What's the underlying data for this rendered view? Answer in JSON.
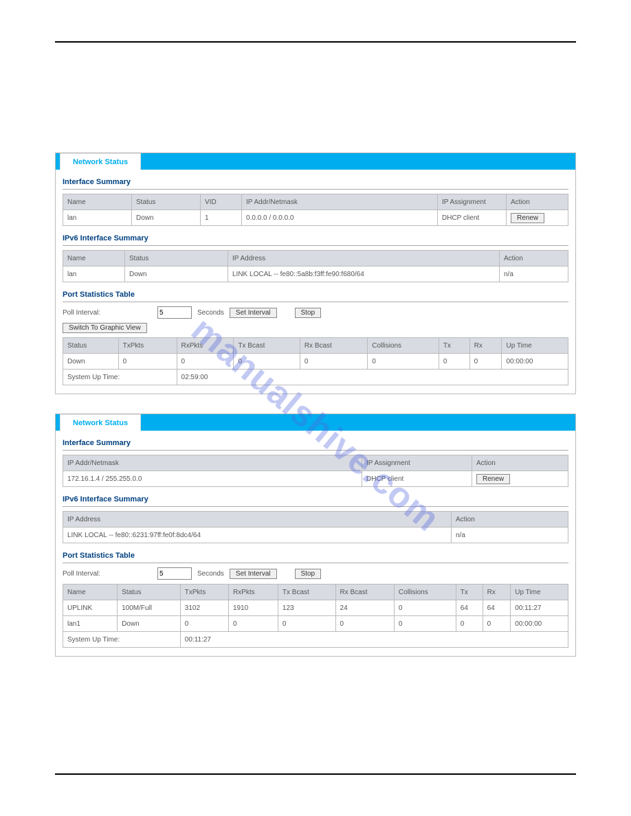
{
  "watermark": "manualshive.com",
  "panels": [
    {
      "tab": "Network Status",
      "sections": {
        "interface_summary": {
          "title": "Interface Summary",
          "headers": [
            "Name",
            "Status",
            "VID",
            "IP Addr/Netmask",
            "IP Assignment",
            "Action"
          ],
          "rows": [
            {
              "name": "lan",
              "status": "Down",
              "vid": "1",
              "ip": "0.0.0.0 / 0.0.0.0",
              "assign": "DHCP client",
              "action": "Renew"
            }
          ]
        },
        "ipv6_summary": {
          "title": "IPv6 Interface Summary",
          "headers": [
            "Name",
            "Status",
            "IP Address",
            "Action"
          ],
          "rows": [
            {
              "name": "lan",
              "status": "Down",
              "ip": "LINK LOCAL -- fe80::5a8b:f3ff:fe90:f680/64",
              "action": "n/a"
            }
          ]
        },
        "port_stats": {
          "title": "Port Statistics Table",
          "poll_label": "Poll Interval:",
          "poll_value": "5",
          "seconds": "Seconds",
          "set_interval": "Set Interval",
          "stop": "Stop",
          "switch_view": "Switch To Graphic View",
          "headers": [
            "Status",
            "TxPkts",
            "RxPkts",
            "Tx Bcast",
            "Rx Bcast",
            "Collisions",
            "Tx",
            "Rx",
            "Up Time"
          ],
          "rows": [
            {
              "c": [
                "Down",
                "0",
                "0",
                "0",
                "0",
                "0",
                "0",
                "0",
                "00:00:00"
              ]
            }
          ],
          "sysup_label": "System Up Time:",
          "sysup_value": "02:59:00"
        }
      }
    },
    {
      "tab": "Network Status",
      "sections": {
        "interface_summary": {
          "title": "Interface Summary",
          "headers": [
            "IP Addr/Netmask",
            "IP Assignment",
            "Action"
          ],
          "rows": [
            {
              "ip": "172.16.1.4 / 255.255.0.0",
              "assign": "DHCP client",
              "action": "Renew"
            }
          ]
        },
        "ipv6_summary": {
          "title": "IPv6 Interface Summary",
          "headers": [
            "IP Address",
            "Action"
          ],
          "rows": [
            {
              "ip": "LINK LOCAL -- fe80::6231:97ff:fe0f:8dc4/64",
              "action": "n/a"
            }
          ]
        },
        "port_stats": {
          "title": "Port Statistics Table",
          "poll_label": "Poll Interval:",
          "poll_value": "5",
          "seconds": "Seconds",
          "set_interval": "Set Interval",
          "stop": "Stop",
          "headers": [
            "Name",
            "Status",
            "TxPkts",
            "RxPkts",
            "Tx Bcast",
            "Rx Bcast",
            "Collisions",
            "Tx",
            "Rx",
            "Up Time"
          ],
          "rows": [
            {
              "c": [
                "UPLINK",
                "100M/Full",
                "3102",
                "1910",
                "123",
                "24",
                "0",
                "64",
                "64",
                "00:11:27"
              ]
            },
            {
              "c": [
                "lan1",
                "Down",
                "0",
                "0",
                "0",
                "0",
                "0",
                "0",
                "0",
                "00:00:00"
              ]
            }
          ],
          "sysup_label": "System Up Time:",
          "sysup_value": "00:11:27"
        }
      }
    }
  ]
}
